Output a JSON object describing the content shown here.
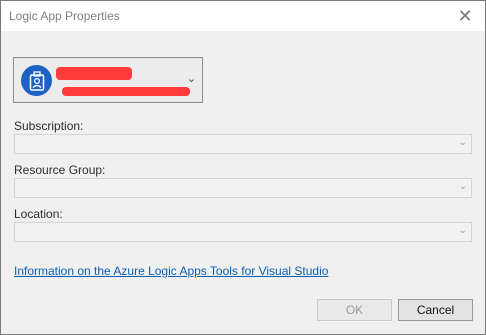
{
  "window": {
    "title": "Logic App Properties",
    "close_glyph": "✕"
  },
  "account": {
    "name": "redacted",
    "email": "redacted",
    "avatar_icon": "id-badge-icon",
    "chevron_glyph": "⌄"
  },
  "fields": {
    "subscription": {
      "label": "Subscription:",
      "value": ""
    },
    "resource_group": {
      "label": "Resource Group:",
      "value": ""
    },
    "location": {
      "label": "Location:",
      "value": ""
    },
    "dropdown_arrow": "⌄"
  },
  "link": {
    "text": "Information on the Azure Logic Apps Tools for Visual Studio"
  },
  "buttons": {
    "ok_label": "OK",
    "cancel_label": "Cancel"
  },
  "colors": {
    "accent": "#1b62c4",
    "link": "#0a5fb3",
    "redaction": "#ff3b3b"
  }
}
